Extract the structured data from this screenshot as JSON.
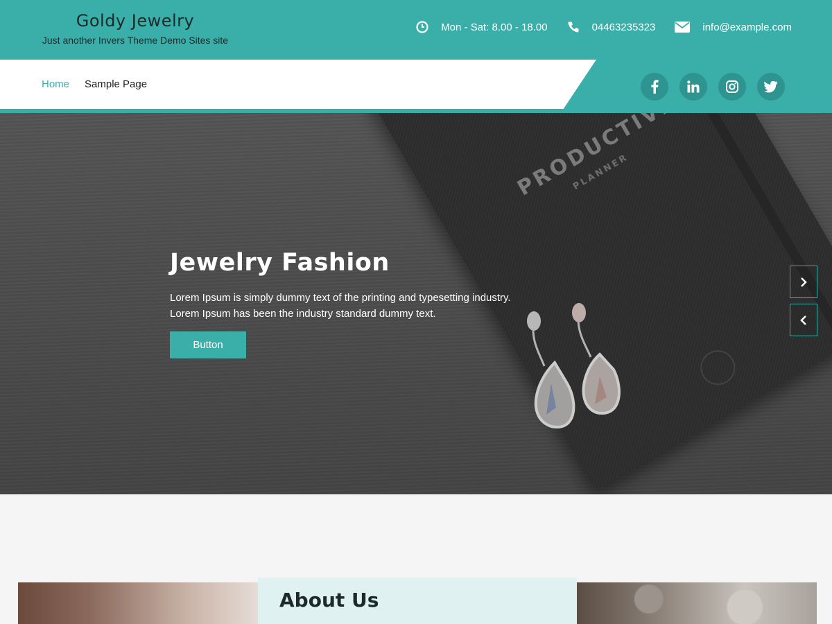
{
  "site": {
    "title": "Goldy Jewelry",
    "tagline": "Just another Invers Theme Demo Sites site"
  },
  "contact": {
    "hours": "Mon - Sat: 8.00 - 18.00",
    "phone": "04463235323",
    "email": "info@example.com",
    "icons": [
      "clock-icon",
      "phone-icon",
      "envelope-icon"
    ]
  },
  "nav": {
    "items": [
      {
        "label": "Home",
        "active": true
      },
      {
        "label": "Sample Page",
        "active": false
      }
    ]
  },
  "social": [
    "facebook-icon",
    "linkedin-icon",
    "instagram-icon",
    "twitter-icon"
  ],
  "hero": {
    "title": "Jewelry Fashion",
    "text_line1": "Lorem Ipsum is simply dummy text of the printing and typesetting industry.",
    "text_line2": "Lorem Ipsum has been the industry standard dummy text.",
    "button_label": "Button",
    "notebook_text1": "PRODUCTIVITY",
    "notebook_text2": "PLANNER"
  },
  "about": {
    "title": "About Us"
  },
  "colors": {
    "accent": "#3aaea9",
    "accent_dark": "#2d948f"
  }
}
